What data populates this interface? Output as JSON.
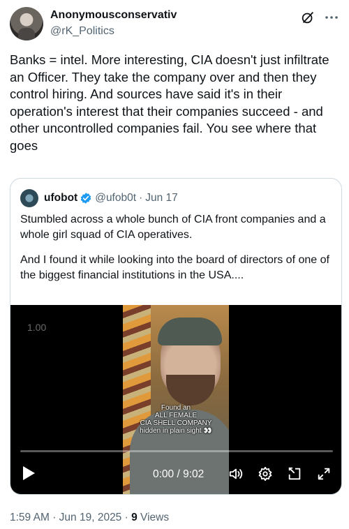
{
  "author": {
    "display_name": "Anonymousconservativ",
    "handle": "@rK_Politics"
  },
  "tweet": {
    "text": "Banks = intel. More interesting, CIA doesn't just infiltrate an Officer. They take the company over and then they control hiring. And sources have said it's in their operation's interest that their companies succeed - and other uncontrolled companies fail. You see where that goes"
  },
  "quote": {
    "display_name": "ufobot",
    "handle": "@ufob0t",
    "separator": "·",
    "date": "Jun 17",
    "verified_color": "#1d9bf0",
    "paragraph1": "Stumbled across a whole bunch of CIA front companies and a whole girl squad of CIA operatives.",
    "paragraph2": "And I found it while looking into the board of directors of one of the biggest financial institutions in the USA...."
  },
  "video": {
    "playback_rate": "1.00",
    "caption_lines": [
      "Found an",
      "ALL FEMALE",
      "CIA SHELL COMPANY",
      "hidden in plain sight 👀"
    ],
    "time": "0:00 / 9:02",
    "progress": 0
  },
  "meta": {
    "time": "1:59 AM",
    "separator": "·",
    "date": "Jun 19, 2025",
    "views_sep": "·",
    "views_count": "9",
    "views_label": "Views"
  },
  "icons": {
    "grok": "grok-icon",
    "more": "more-icon",
    "verified": "verified-badge-icon",
    "play": "play-icon",
    "volume": "volume-icon",
    "settings": "gear-icon",
    "download": "download-icon",
    "fullscreen": "fullscreen-icon"
  }
}
